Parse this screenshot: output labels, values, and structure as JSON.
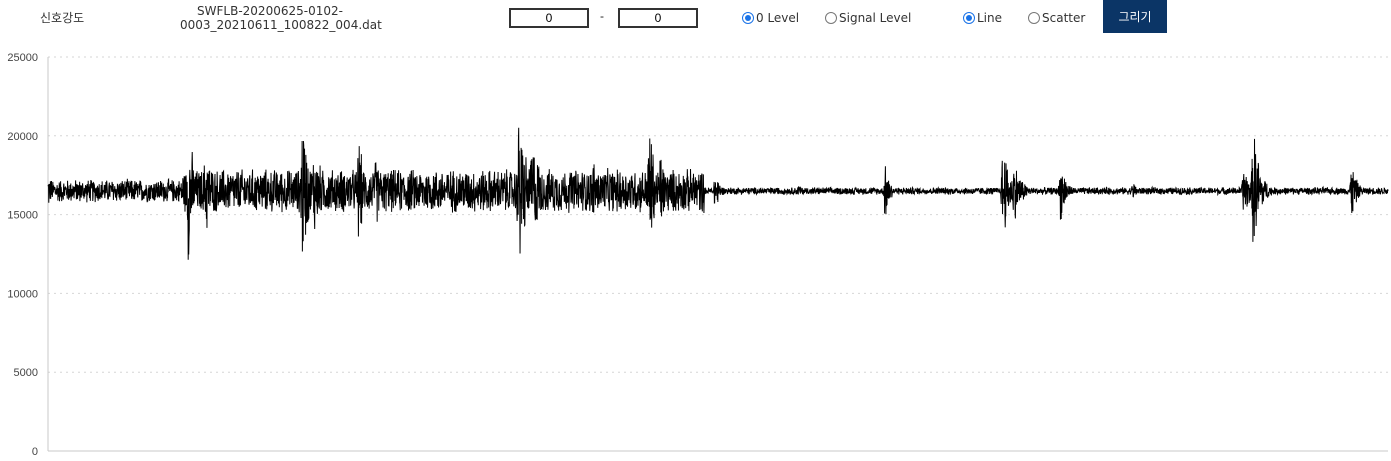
{
  "toolbar": {
    "title": "신호강도",
    "file_name_line1": "SWFLB-20200625-0102-",
    "file_name_line2": "0003_20210611_100822_004.dat",
    "range_start": "0",
    "range_separator": "-",
    "range_end": "0",
    "level_options": [
      {
        "label": "0 Level",
        "selected": true
      },
      {
        "label": "Signal Level",
        "selected": false
      }
    ],
    "plot_type_options": [
      {
        "label": "Line",
        "selected": true
      },
      {
        "label": "Scatter",
        "selected": false
      }
    ],
    "draw_button_label": "그리기",
    "accent_color": "#0b3566",
    "radio_color": "#1a73e8"
  },
  "chart_data": {
    "type": "line",
    "title": "",
    "xlabel": "",
    "ylabel": "",
    "ylim": [
      0,
      25000
    ],
    "yticks": [
      0,
      5000,
      10000,
      15000,
      20000,
      25000
    ],
    "grid": "horizontal-dotted",
    "line_color": "#000000",
    "baseline": 16500,
    "samples": 5000,
    "series": [
      {
        "segments": [
          {
            "start": 0.0,
            "end": 0.1,
            "amplitude": 800
          },
          {
            "start": 0.1,
            "end": 0.49,
            "amplitude": 1500
          },
          {
            "start": 0.49,
            "end": 1.0,
            "amplitude": 250
          }
        ],
        "bursts": [
          {
            "center": 0.0,
            "amplitude": 1400,
            "width": 0.004
          },
          {
            "center": 0.105,
            "amplitude": 5200,
            "width": 0.004
          },
          {
            "center": 0.118,
            "amplitude": 3200,
            "width": 0.006
          },
          {
            "center": 0.19,
            "amplitude": 5500,
            "width": 0.005
          },
          {
            "center": 0.199,
            "amplitude": 3000,
            "width": 0.008
          },
          {
            "center": 0.232,
            "amplitude": 4000,
            "width": 0.004
          },
          {
            "center": 0.245,
            "amplitude": 2500,
            "width": 0.005
          },
          {
            "center": 0.352,
            "amplitude": 5700,
            "width": 0.006
          },
          {
            "center": 0.362,
            "amplitude": 3500,
            "width": 0.008
          },
          {
            "center": 0.407,
            "amplitude": 2500,
            "width": 0.003
          },
          {
            "center": 0.449,
            "amplitude": 5300,
            "width": 0.004
          },
          {
            "center": 0.457,
            "amplitude": 3000,
            "width": 0.005
          },
          {
            "center": 0.498,
            "amplitude": 1800,
            "width": 0.003
          },
          {
            "center": 0.625,
            "amplitude": 2500,
            "width": 0.003
          },
          {
            "center": 0.713,
            "amplitude": 4000,
            "width": 0.004
          },
          {
            "center": 0.721,
            "amplitude": 2200,
            "width": 0.006
          },
          {
            "center": 0.756,
            "amplitude": 2200,
            "width": 0.004
          },
          {
            "center": 0.9,
            "amplitude": 4400,
            "width": 0.005
          },
          {
            "center": 0.893,
            "amplitude": 1800,
            "width": 0.006
          },
          {
            "center": 0.973,
            "amplitude": 2000,
            "width": 0.004
          },
          {
            "center": 0.81,
            "amplitude": 600,
            "width": 0.006
          },
          {
            "center": 0.56,
            "amplitude": 450,
            "width": 0.006
          }
        ]
      }
    ]
  }
}
